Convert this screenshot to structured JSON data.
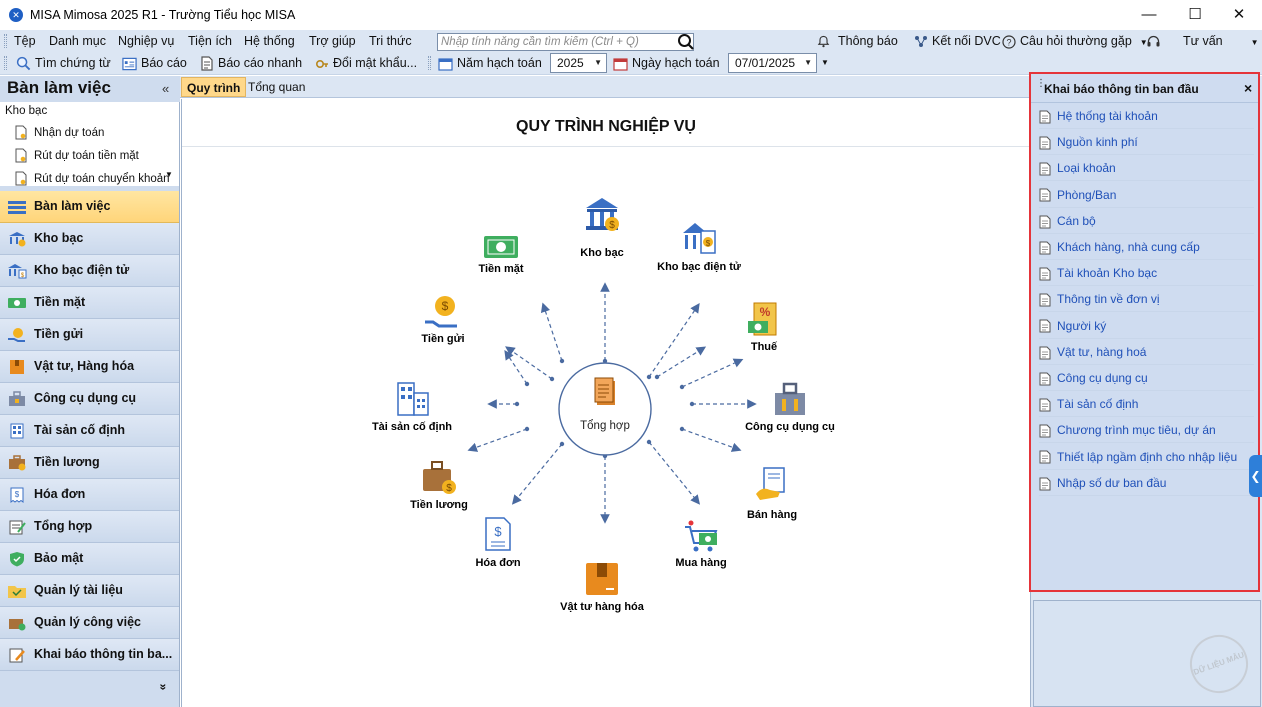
{
  "window": {
    "title": "MISA Mimosa 2025 R1 - Trường Tiểu học MISA",
    "minimize": "—",
    "maximize": "☐",
    "close": "✕"
  },
  "menu": {
    "items": [
      "Tệp",
      "Danh mục",
      "Nghiệp vụ",
      "Tiện ích",
      "Hệ thống",
      "Trợ giúp",
      "Tri thức"
    ],
    "search_placeholder": "Nhập tính năng cần tìm kiếm (Ctrl + Q)",
    "notifications": "Thông báo",
    "connect_dvc": "Kết nối DVC",
    "faq": "Câu hỏi thường gặp",
    "support": "Tư vấn"
  },
  "toolbar": {
    "find_voucher": "Tìm chứng từ",
    "report": "Báo cáo",
    "quick_report": "Báo cáo nhanh",
    "change_password": "Đổi mật khẩu...",
    "fiscal_year_label": "Năm hạch toán",
    "fiscal_year": "2025",
    "posting_date_label": "Ngày hạch toán",
    "posting_date": "07/01/2025"
  },
  "left_panel": {
    "title": "Bàn làm việc",
    "collapse": "«",
    "group": "Kho bạc",
    "sub_items": [
      "Nhận dự toán",
      "Rút dự toán tiền mặt",
      "Rút dự toán chuyển khoản"
    ],
    "nav": [
      "Bàn làm việc",
      "Kho bạc",
      "Kho bạc điện tử",
      "Tiền mặt",
      "Tiền gửi",
      "Vật tư, Hàng hóa",
      "Công cụ dụng cụ",
      "Tài sản cố định",
      "Tiền lương",
      "Hóa đơn",
      "Tổng hợp",
      "Bảo mật",
      "Quản lý tài liệu",
      "Quản lý công việc",
      "Khai báo thông tin ba..."
    ],
    "active": "Bàn làm việc",
    "more": "»"
  },
  "tabs": {
    "items": [
      "Quy trình",
      "Tổng quan"
    ],
    "active": "Quy trình"
  },
  "process": {
    "title": "QUY TRÌNH NGHIỆP VỤ",
    "center": "Tổng hợp",
    "nodes": [
      "Kho bạc",
      "Kho bạc điện tử",
      "Thuế",
      "Công cụ dụng cụ",
      "Bán hàng",
      "Mua hàng",
      "Vật tư hàng hóa",
      "Hóa đơn",
      "Tiền lương",
      "Tài sản cố định",
      "Tiền gửi",
      "Tiền mặt"
    ]
  },
  "right_panel": {
    "title": "Khai báo thông tin ban đầu",
    "close": "×",
    "items": [
      "Hệ thống tài khoản",
      "Nguồn kinh phí",
      "Loại khoản",
      "Phòng/Ban",
      "Cán bộ",
      "Khách hàng, nhà cung cấp",
      "Tài khoản Kho bạc",
      "Thông tin về đơn vị",
      "Người ký",
      "Vật tư, hàng hoá",
      "Công cụ dụng cụ",
      "Tài sản cố định",
      "Chương trình mục tiêu, dự án",
      "Thiết lập ngầm định cho nhập liệu",
      "Nhập số dư ban đầu"
    ],
    "edge": "❮"
  },
  "watermark": "DỮ LIỆU MẪU",
  "colors": {
    "menubar": "#dce6f3",
    "active_nav": "#ffd57a",
    "link": "#1f50b8",
    "highlight_border": "#e5343a",
    "accent": "#2e7fd9"
  }
}
